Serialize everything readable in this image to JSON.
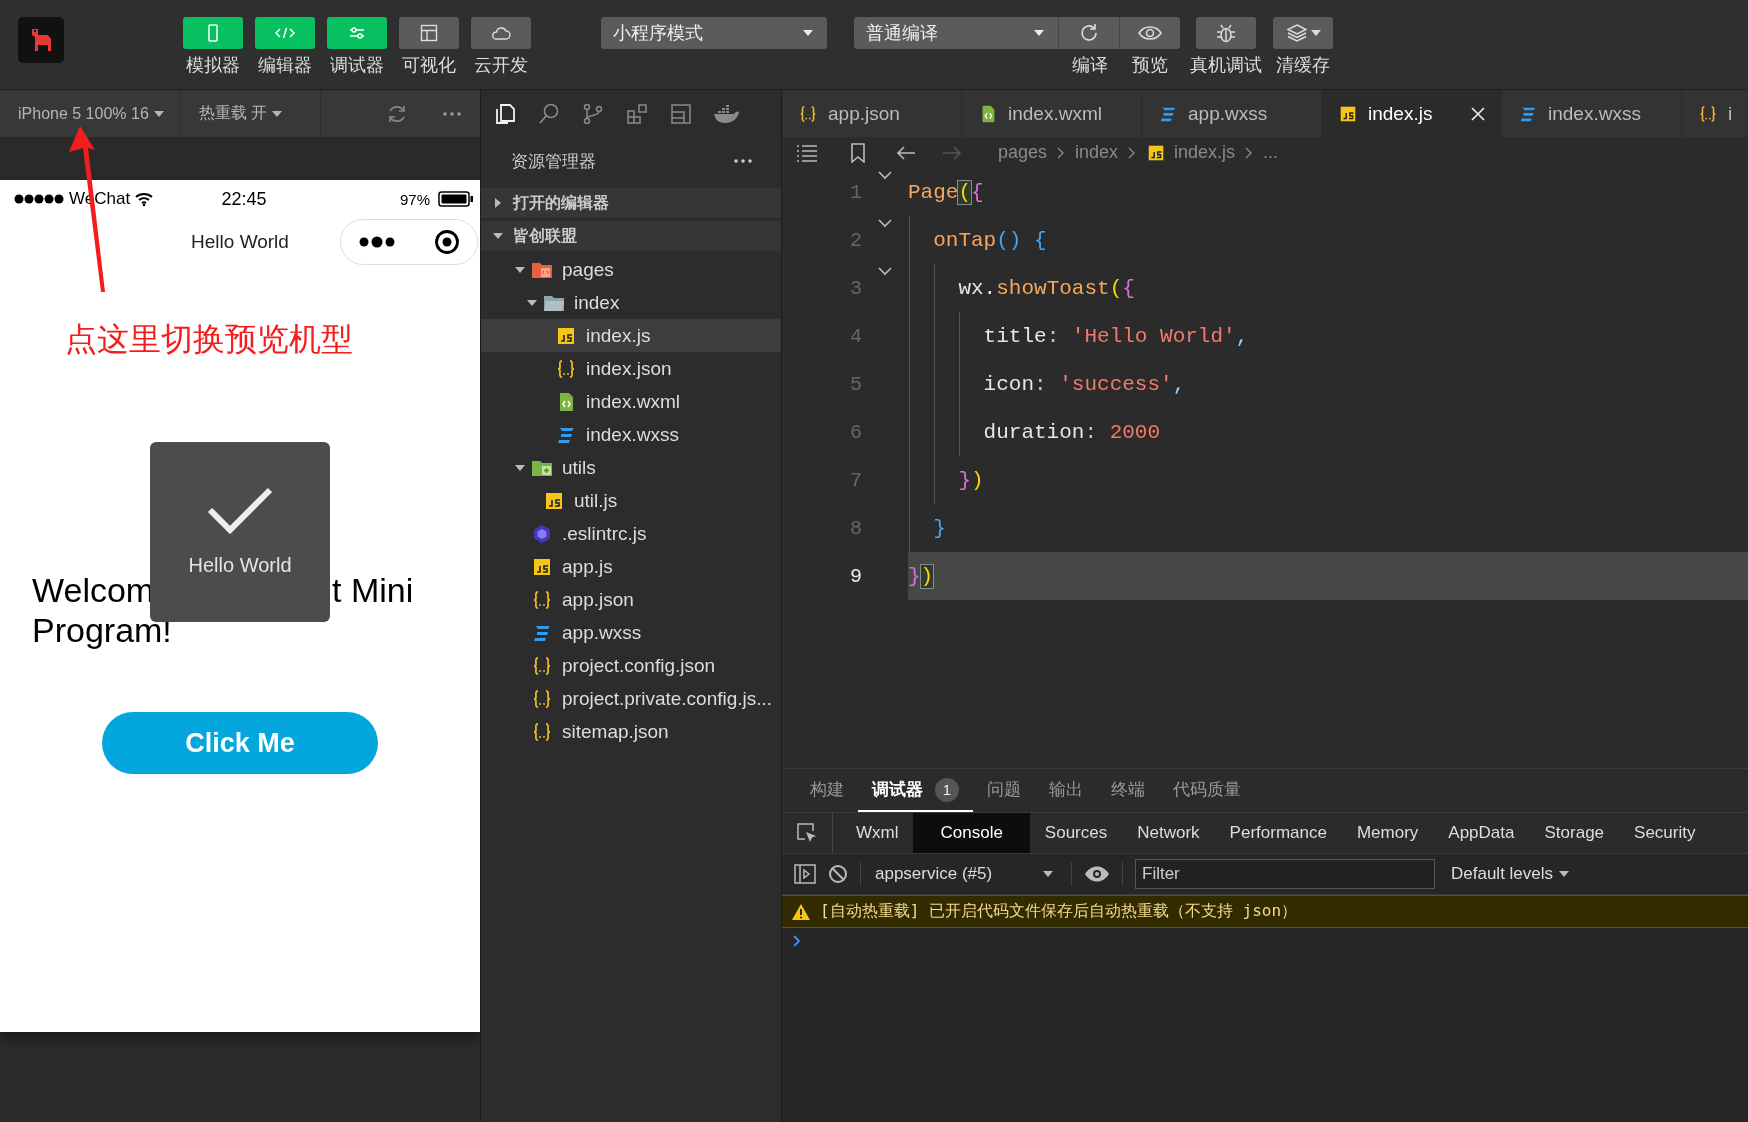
{
  "toolbar": {
    "modes": [
      {
        "label": "模拟器",
        "kind": "simulator",
        "selected": true
      },
      {
        "label": "编辑器",
        "kind": "editor",
        "selected": true
      },
      {
        "label": "调试器",
        "kind": "debugger",
        "selected": true
      },
      {
        "label": "可视化",
        "kind": "visual",
        "selected": false
      },
      {
        "label": "云开发",
        "kind": "cloud",
        "selected": false
      }
    ],
    "mode_select": "小程序模式",
    "compile_select": "普通编译",
    "actions": [
      {
        "label": "编译",
        "kind": "compile"
      },
      {
        "label": "预览",
        "kind": "preview"
      },
      {
        "label": "真机调试",
        "kind": "device"
      },
      {
        "label": "清缓存",
        "kind": "cache"
      }
    ]
  },
  "simulator": {
    "device": "iPhone 5 100% 16",
    "hot_reload": "热重载 开",
    "status_bar": {
      "carrier": "WeChat",
      "time": "22:45",
      "battery": "97%"
    },
    "nav_title": "Hello World",
    "welcome": [
      "Welcom",
      "t Mini",
      "Program!"
    ],
    "button": "Click Me",
    "toast": {
      "title": "Hello World"
    },
    "annotation": "点这里切换预览机型"
  },
  "explorer": {
    "tools": [
      {
        "kind": "files",
        "selected": true
      },
      {
        "kind": "search",
        "selected": false
      },
      {
        "kind": "git",
        "selected": false
      },
      {
        "kind": "extensions",
        "selected": false
      },
      {
        "kind": "outline",
        "selected": false
      },
      {
        "kind": "docker",
        "selected": false
      }
    ],
    "title": "资源管理器",
    "sections": [
      {
        "label": "打开的编辑器",
        "expanded": false
      },
      {
        "label": "皆创联盟",
        "expanded": true,
        "children": [
          {
            "label": "pages",
            "kind": "folder-pages",
            "expanded": true,
            "selected": false,
            "children": [
              {
                "label": "index",
                "kind": "folder",
                "expanded": true,
                "selected": false,
                "children": [
                  {
                    "label": "index.js",
                    "kind": "js",
                    "selected": true
                  },
                  {
                    "label": "index.json",
                    "kind": "json",
                    "selected": false
                  },
                  {
                    "label": "index.wxml",
                    "kind": "wxml",
                    "selected": false
                  },
                  {
                    "label": "index.wxss",
                    "kind": "wxss",
                    "selected": false
                  }
                ]
              }
            ]
          },
          {
            "label": "utils",
            "kind": "folder-utils",
            "expanded": true,
            "selected": false,
            "children": [
              {
                "label": "util.js",
                "kind": "js",
                "selected": false
              }
            ]
          },
          {
            "label": ".eslintrc.js",
            "kind": "eslint",
            "selected": false
          },
          {
            "label": "app.js",
            "kind": "js",
            "selected": false
          },
          {
            "label": "app.json",
            "kind": "json",
            "selected": false
          },
          {
            "label": "app.wxss",
            "kind": "wxss",
            "selected": false
          },
          {
            "label": "project.config.json",
            "kind": "json",
            "selected": false
          },
          {
            "label": "project.private.config.js...",
            "kind": "json",
            "selected": false
          },
          {
            "label": "sitemap.json",
            "kind": "json",
            "selected": false
          }
        ]
      }
    ]
  },
  "editor": {
    "tabs": [
      {
        "label": "app.json",
        "kind": "json",
        "selected": false
      },
      {
        "label": "index.wxml",
        "kind": "wxml",
        "selected": false
      },
      {
        "label": "app.wxss",
        "kind": "wxss",
        "selected": false
      },
      {
        "label": "index.js",
        "kind": "js",
        "selected": true
      },
      {
        "label": "index.wxss",
        "kind": "wxss",
        "selected": false
      },
      {
        "label": "i",
        "kind": "json",
        "selected": false
      }
    ],
    "breadcrumb": [
      {
        "label": "pages",
        "kind": "folder"
      },
      {
        "label": "index",
        "kind": "folder"
      },
      {
        "label": "index.js",
        "kind": "js"
      },
      {
        "label": "...",
        "kind": "more"
      }
    ],
    "lines": [
      {
        "number": "1",
        "foldable": true,
        "current": false,
        "tokens": [
          {
            "text": "Page",
            "kind": "function"
          },
          {
            "text": "(",
            "kind": "bracket1",
            "matched": true
          },
          {
            "text": "{",
            "kind": "bracket2"
          }
        ]
      },
      {
        "number": "2",
        "foldable": true,
        "current": false,
        "tokens": [
          {
            "text": "  onTap",
            "kind": "function"
          },
          {
            "text": "() {",
            "kind": "bracket3"
          }
        ]
      },
      {
        "number": "3",
        "foldable": true,
        "current": false,
        "tokens": [
          {
            "text": "    wx.",
            "kind": "plain"
          },
          {
            "text": "showToast",
            "kind": "function"
          },
          {
            "text": "(",
            "kind": "bracket1"
          },
          {
            "text": "{",
            "kind": "bracket2"
          }
        ]
      },
      {
        "number": "4",
        "foldable": false,
        "current": false,
        "tokens": [
          {
            "text": "      title",
            "kind": "plain"
          },
          {
            "text": ": ",
            "kind": "punctuation"
          },
          {
            "text": "'Hello World'",
            "kind": "string"
          },
          {
            "text": ",",
            "kind": "punctuation"
          }
        ]
      },
      {
        "number": "5",
        "foldable": false,
        "current": false,
        "tokens": [
          {
            "text": "      icon",
            "kind": "plain"
          },
          {
            "text": ": ",
            "kind": "punctuation"
          },
          {
            "text": "'success'",
            "kind": "string"
          },
          {
            "text": ",",
            "kind": "punctuation"
          }
        ]
      },
      {
        "number": "6",
        "foldable": false,
        "current": false,
        "tokens": [
          {
            "text": "      duration",
            "kind": "plain"
          },
          {
            "text": ": ",
            "kind": "punctuation"
          },
          {
            "text": "2000",
            "kind": "number"
          }
        ]
      },
      {
        "number": "7",
        "foldable": false,
        "current": false,
        "tokens": [
          {
            "text": "    }",
            "kind": "bracket2"
          },
          {
            "text": ")",
            "kind": "bracket1"
          }
        ]
      },
      {
        "number": "8",
        "foldable": false,
        "current": false,
        "tokens": [
          {
            "text": "  }",
            "kind": "bracket3"
          }
        ]
      },
      {
        "number": "9",
        "foldable": false,
        "current": true,
        "tokens": [
          {
            "text": "}",
            "kind": "bracket2"
          },
          {
            "text": ")",
            "kind": "bracket1",
            "matched": true
          }
        ]
      }
    ]
  },
  "panel": {
    "tabs": [
      {
        "label": "构建",
        "selected": false
      },
      {
        "label": "调试器",
        "selected": true,
        "badge": "1"
      },
      {
        "label": "问题",
        "selected": false
      },
      {
        "label": "输出",
        "selected": false
      },
      {
        "label": "终端",
        "selected": false
      },
      {
        "label": "代码质量",
        "selected": false
      }
    ],
    "devtools_tabs": [
      {
        "label": "Wxml",
        "selected": false
      },
      {
        "label": "Console",
        "selected": true
      },
      {
        "label": "Sources",
        "selected": false
      },
      {
        "label": "Network",
        "selected": false
      },
      {
        "label": "Performance",
        "selected": false
      },
      {
        "label": "Memory",
        "selected": false
      },
      {
        "label": "AppData",
        "selected": false
      },
      {
        "label": "Storage",
        "selected": false
      },
      {
        "label": "Security",
        "selected": false
      }
    ],
    "console": {
      "context": "appservice (#5)",
      "filter": {
        "placeholder": "Filter"
      },
      "levels": "Default levels",
      "messages": [
        {
          "kind": "warning",
          "text": "[自动热重载] 已开启代码文件保存后自动热重载（不支持 json）"
        }
      ]
    }
  }
}
